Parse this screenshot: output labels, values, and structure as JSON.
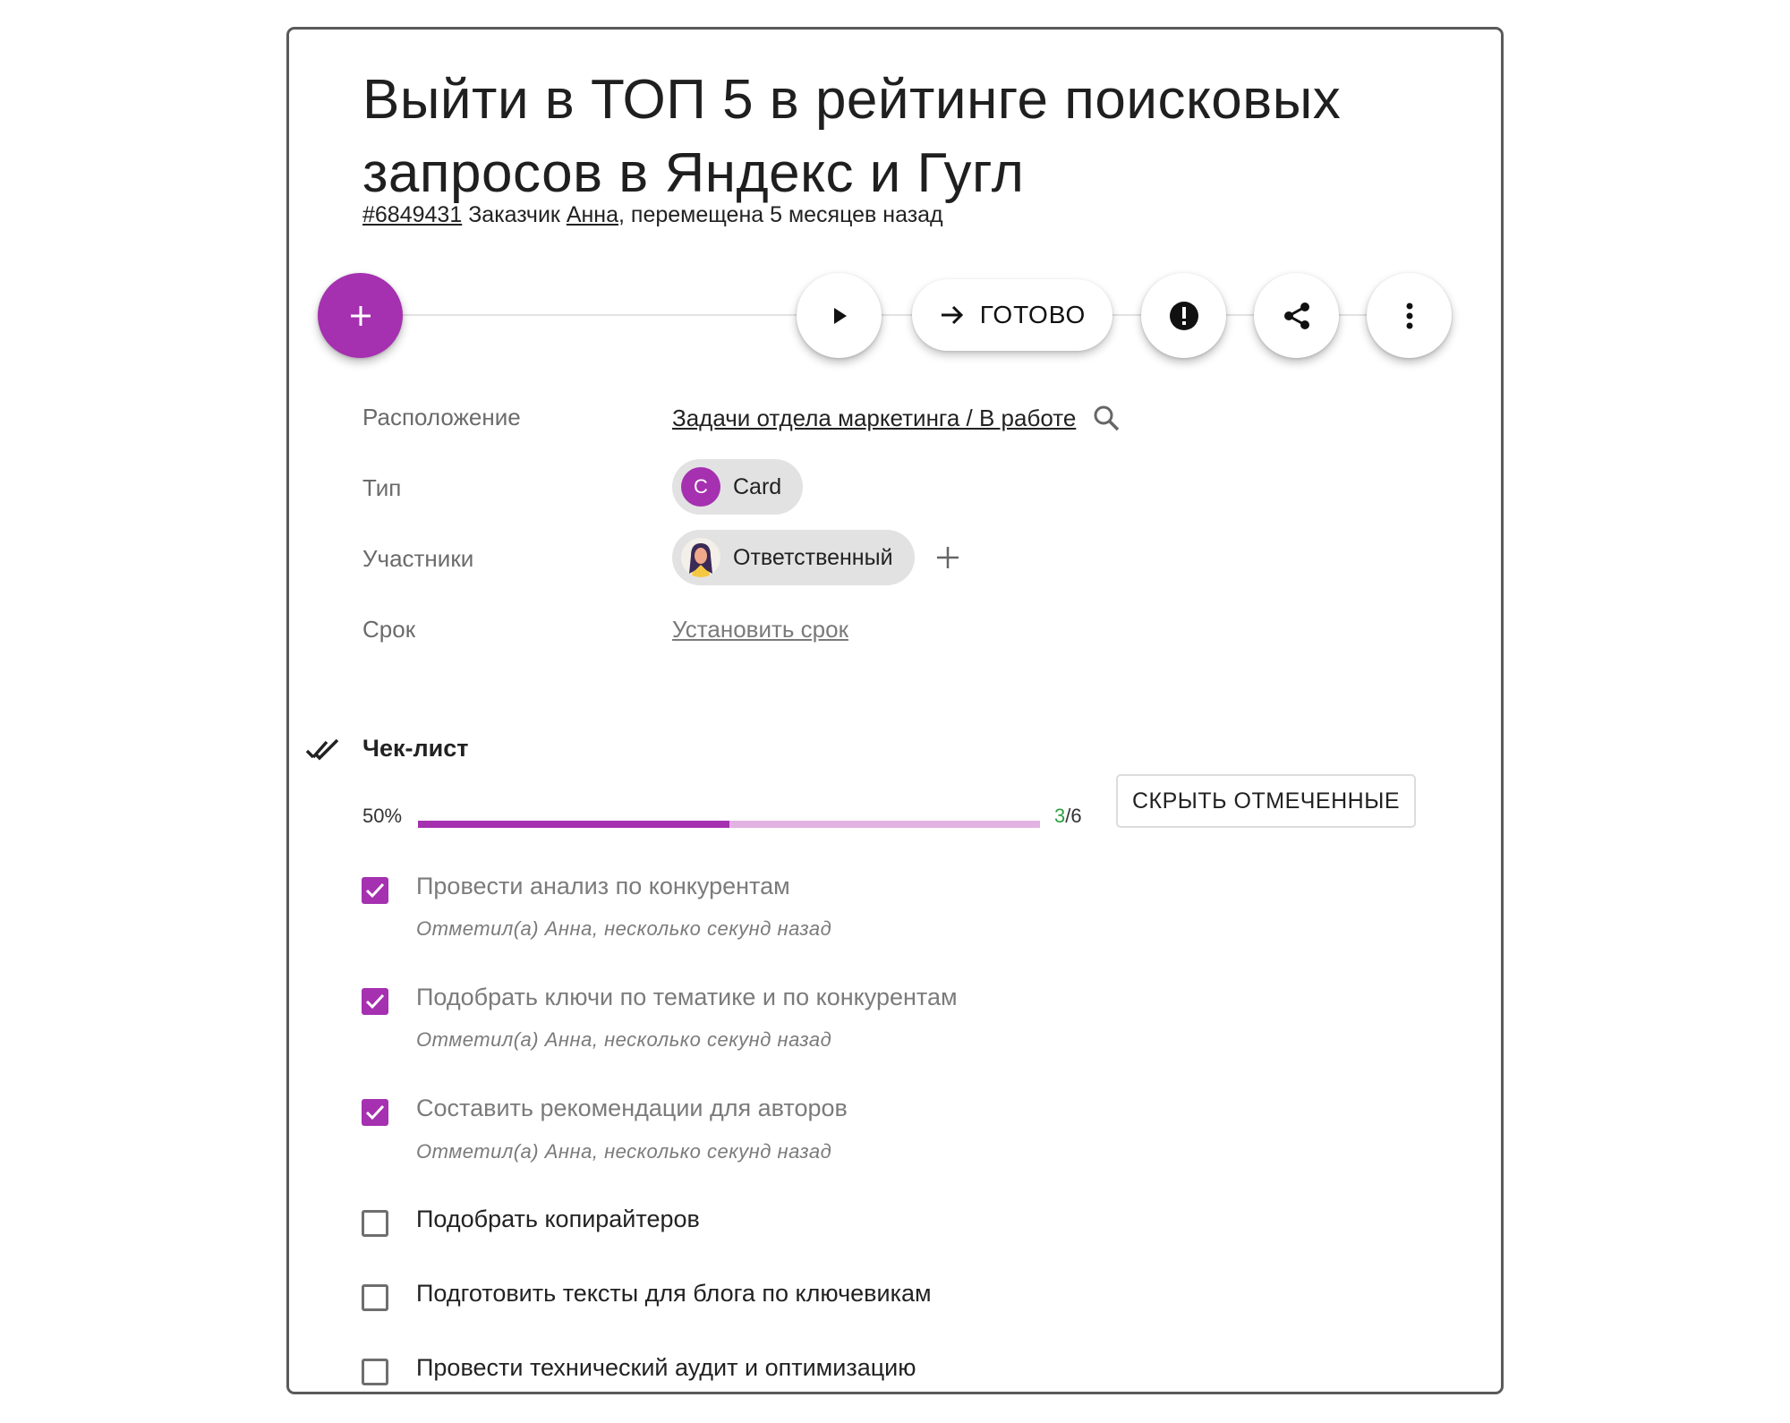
{
  "task": {
    "title": "Выйти в ТОП 5 в рейтинге поисковых запросов в Яндекс и Гугл",
    "id": "#6849431",
    "customer_prefix": "Заказчик",
    "customer": "Анна",
    "moved": ", перемещена 5 месяцев назад"
  },
  "toolbar": {
    "add_icon": "plus-icon",
    "play_icon": "play-icon",
    "done_label": "ГОТОВО",
    "done_icon": "arrow-right-icon",
    "alert_icon": "exclamation-circle-icon",
    "share_icon": "share-icon",
    "more_icon": "more-vertical-icon"
  },
  "fields": {
    "location_label": "Расположение",
    "location_value": "Задачи отдела маркетинга / В работе",
    "type_label": "Тип",
    "type_value": "Card",
    "type_letter": "C",
    "members_label": "Участники",
    "members_value": "Ответственный",
    "deadline_label": "Срок",
    "deadline_value": "Установить срок"
  },
  "checklist": {
    "title": "Чек-лист",
    "percent_label": "50%",
    "progress": 0.5,
    "done_count": "3",
    "total_count": "/6",
    "hide_button": "СКРЫТЬ ОТМЕЧЕННЫЕ",
    "items": [
      {
        "text": "Провести анализ по конкурентам",
        "checked": true,
        "note": "Отметил(а) Анна, несколько секунд назад"
      },
      {
        "text": "Подобрать ключи по тематике и по конкурентам",
        "checked": true,
        "note": "Отметил(а) Анна, несколько секунд назад"
      },
      {
        "text": "Составить рекомендации для авторов",
        "checked": true,
        "note": "Отметил(а) Анна, несколько секунд назад"
      },
      {
        "text": "Подобрать копирайтеров",
        "checked": false
      },
      {
        "text": "Подготовить тексты для блога по ключевикам",
        "checked": false
      },
      {
        "text": "Провести технический аудит и оптимизацию",
        "checked": false
      }
    ]
  },
  "colors": {
    "accent": "#a530b0",
    "accent_light": "#e1b2e2",
    "done_count": "#2ea043"
  }
}
